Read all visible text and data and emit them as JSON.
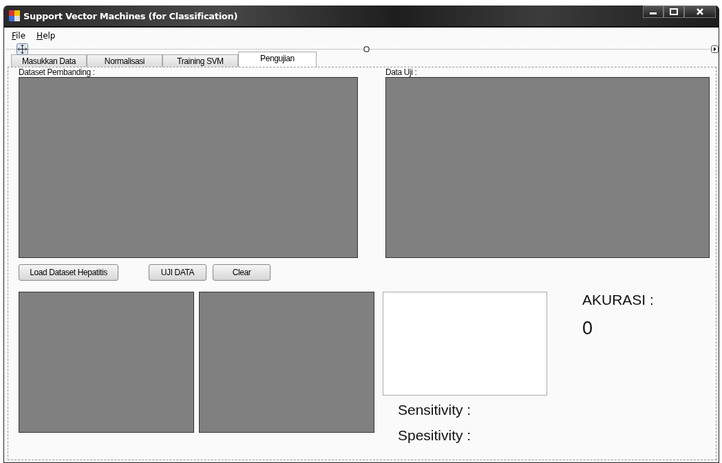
{
  "window": {
    "title": "Support Vector Machines (for Classification)"
  },
  "menu": [
    {
      "label": "File"
    },
    {
      "label": "Help"
    }
  ],
  "tabs": [
    {
      "label": "Masukkan Data",
      "selected": false
    },
    {
      "label": "Normalisasi",
      "selected": false
    },
    {
      "label": "Training SVM",
      "selected": false
    },
    {
      "label": "Pengujian",
      "selected": true
    }
  ],
  "comparison_dataset": {
    "label": "Dataset Pembanding :"
  },
  "test_data": {
    "label": "Data Uji :"
  },
  "buttons": [
    {
      "label": "Load Dataset Hepatitis"
    },
    {
      "label": "UJI DATA"
    },
    {
      "label": "Clear"
    }
  ],
  "accuracy": {
    "label": "AKURASI :",
    "value": "0"
  },
  "sensitivity": {
    "label": "Sensitivity :"
  },
  "specificity": {
    "label": "Spesitivity :"
  }
}
